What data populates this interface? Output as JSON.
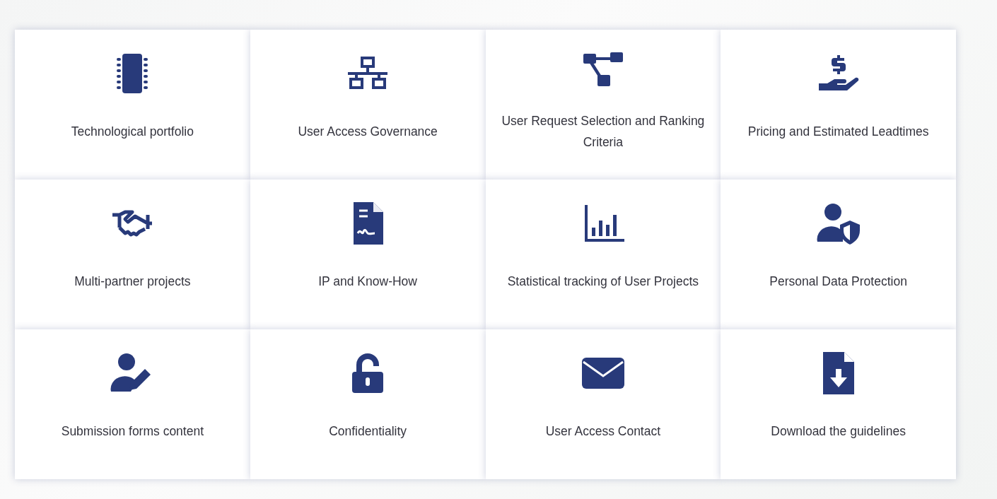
{
  "cards": [
    {
      "label": "Technological portfolio"
    },
    {
      "label": "User Access Governance"
    },
    {
      "label": "User Request Selection and Ranking Criteria"
    },
    {
      "label": "Pricing and Estimated Leadtimes"
    },
    {
      "label": "Multi-partner projects"
    },
    {
      "label": "IP and Know-How"
    },
    {
      "label": "Statistical tracking of User Projects"
    },
    {
      "label": "Personal Data Protection"
    },
    {
      "label": "Submission forms content"
    },
    {
      "label": "Confidentiality"
    },
    {
      "label": "User Access Contact"
    },
    {
      "label": "Download the guidelines"
    }
  ]
}
